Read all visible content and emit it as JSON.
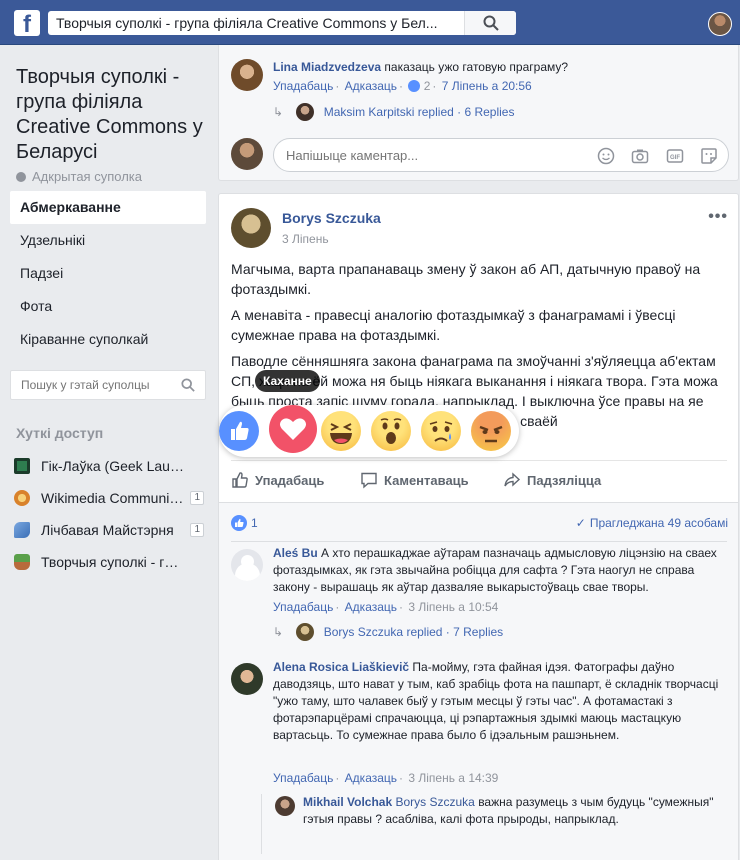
{
  "topbar": {
    "logo": "f",
    "search_value": "Творчыя суполкі - група філіяла Creative Commons у Бел..."
  },
  "sidebar": {
    "group_title": "Творчыя суполкі - група філіяла Creative Commons у Беларусі",
    "group_type": "Адкрытая суполка",
    "nav": [
      "Абмеркаванне",
      "Удзельнікі",
      "Падзеі",
      "Фота",
      "Кіраванне суполкай"
    ],
    "search_placeholder": "Пошук у гэтай суполцы",
    "quick_access_title": "Хуткі доступ",
    "quick_items": [
      {
        "label": "Гік-Лаўка (Geek Lauka)",
        "count": ""
      },
      {
        "label": "Wikimedia Communit…",
        "count": "1"
      },
      {
        "label": "Лічбавая Майстэрня",
        "count": "1"
      },
      {
        "label": "Творчыя суполкі - гру…",
        "count": ""
      }
    ]
  },
  "prev_post": {
    "comment_author": "Lina Miadzvedzeva",
    "comment_text": "паказаць ужо гатовую праграму?",
    "like": "Упадабаць",
    "reply": "Адказаць",
    "likes": "2",
    "time": "7 Ліпень а 20:56",
    "replies_link": "Maksim Karpitski replied · 6 Replies",
    "comment_placeholder": "Напішыце каментар..."
  },
  "post": {
    "author": "Borys Szczuka",
    "date": "3 Ліпень",
    "body": [
      "Магчыма, варта прапанаваць змену ў закон аб АП, датычную правоў на фотаздымкі.",
      "А менавіта - правесці аналогію фотаздымкаў з фанаграмамі і ўвесці сумежнае права на фотаздымкі.",
      "Паводле сённяшняга закона фанаграма па змоўчанні з'яўляецца аб'ектам СП, хаця на ёй можа ня быць ніякага выканання і ніякага твора. Гэта можа быць проста запіс шуму горада, напрыклад. І выключна ўсе правы на яе належаць тому, хто, ключыўшы гуказапіс на сваёй"
    ],
    "tooltip": "Каханне",
    "actions": [
      "Упадабаць",
      "Каментаваць",
      "Падзяліцца"
    ],
    "like_count": "1",
    "seen": "Прагледжана 49 асобамі",
    "comments": [
      {
        "author": "Aleś Bu",
        "text": "А хто перашкаджае аўтарам пазначаць адмысловую ліцэнзію на сваех фотаздымках, як гэта звычайна робіцца для сафта ? Гэта наогул не справа закону - вырашаць як аўтар дазваляе выкарыстоўваць свае творы.",
        "like": "Упадабаць",
        "reply": "Адказаць",
        "time": "3 Ліпень а 10:54",
        "replies_link": "Borys Szczuka replied · 7 Replies"
      },
      {
        "author": "Alena Rosica Liaškievič",
        "text": "Па-мойму, гэта файная ідэя. Фатографы даўно даводзяць, што нават у тым, каб зрабіць фота на пашпарт, ё складнік творчасці \"ужо таму, што чалавек быў у гэтым месцы ў гэты час\". А фотамастакі з фотарэпарцёрамі спрачаюцца, ці рэпартажныя здымкі маюць мастацкую вартасьць. То сумежнае права было б ідэальным рашэньнем.",
        "like": "Упадабаць",
        "reply": "Адказаць",
        "time": "3 Ліпень а 14:39"
      },
      {
        "author": "Mikhail Volchak",
        "mention": "Borys Szczuka",
        "text": "важна разумець з чым будуць \"сумежныя\" гэтыя правы ? асабліва, калі фота прыроды, напрыклад."
      }
    ]
  },
  "colors": {
    "brand": "#3b5998",
    "link": "#4267b2",
    "background": "#e9ebee"
  }
}
